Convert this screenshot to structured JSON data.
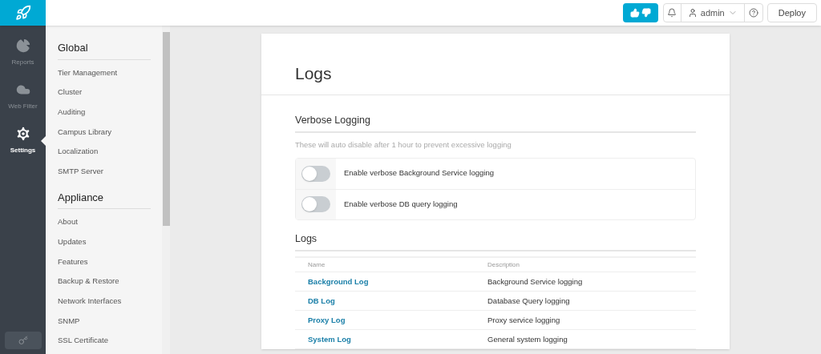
{
  "topbar": {
    "user": "admin",
    "deploy": "Deploy"
  },
  "rail": [
    {
      "label": "Reports",
      "selected": false,
      "kind": "reports"
    },
    {
      "label": "Web Filter",
      "selected": false,
      "kind": "webfilter"
    },
    {
      "label": "Settings",
      "selected": true,
      "kind": "settings"
    }
  ],
  "sidebar": [
    {
      "heading": "Global",
      "items": [
        "Tier Management",
        "Cluster",
        "Auditing",
        "Campus Library",
        "Localization",
        "SMTP Server"
      ]
    },
    {
      "heading": "Appliance",
      "items": [
        "About",
        "Updates",
        "Features",
        "Backup & Restore",
        "Network Interfaces",
        "SNMP",
        "SSL Certificate"
      ]
    }
  ],
  "page": {
    "title": "Logs",
    "verbose": {
      "heading": "Verbose Logging",
      "hint": "These will auto disable after 1 hour to prevent excessive logging",
      "toggles": [
        {
          "label": "Enable verbose Background Service logging",
          "on": false
        },
        {
          "label": "Enable verbose DB query logging",
          "on": false
        }
      ]
    },
    "logs": {
      "heading": "Logs",
      "columns": [
        "Name",
        "Description"
      ],
      "rows": [
        {
          "name": "Background Log",
          "description": "Background Service logging"
        },
        {
          "name": "DB Log",
          "description": "Database Query logging"
        },
        {
          "name": "Proxy Log",
          "description": "Proxy service logging"
        },
        {
          "name": "System Log",
          "description": "General system logging"
        }
      ]
    }
  }
}
